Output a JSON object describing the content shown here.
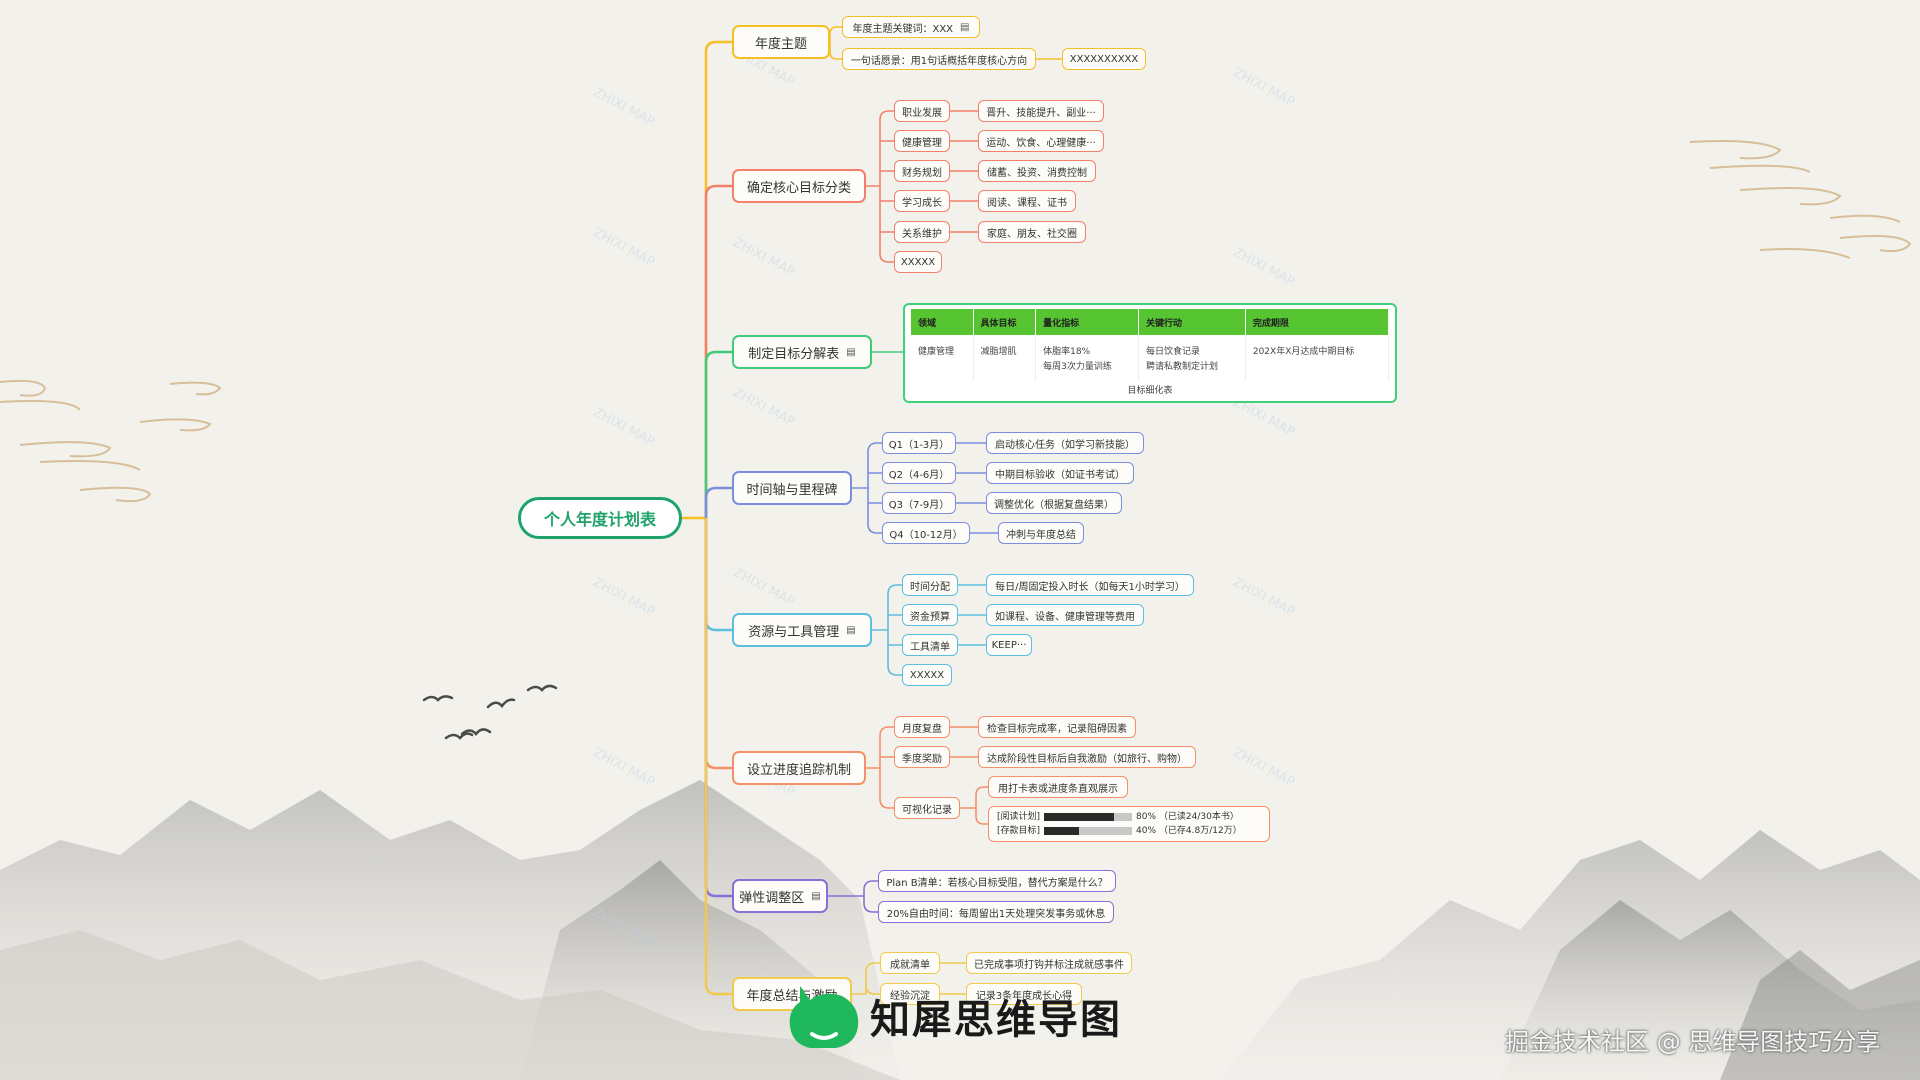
{
  "root": {
    "label": "个人年度计划表"
  },
  "theme": {
    "label": "年度主题",
    "items": [
      {
        "label": "年度主题关键词：XXX",
        "note_icon": "note-icon"
      },
      {
        "label": "一句话愿景：用1句话概括年度核心方向",
        "value": "XXXXXXXXXX"
      }
    ]
  },
  "goals": {
    "label": "确定核心目标分类",
    "items": [
      {
        "label": "职业发展",
        "detail": "晋升、技能提升、副业···"
      },
      {
        "label": "健康管理",
        "detail": "运动、饮食、心理健康···"
      },
      {
        "label": "财务规划",
        "detail": "储蓄、投资、消费控制"
      },
      {
        "label": "学习成长",
        "detail": "阅读、课程、证书"
      },
      {
        "label": "关系维护",
        "detail": "家庭、朋友、社交圈"
      },
      {
        "label": "XXXXX"
      }
    ]
  },
  "decompose": {
    "label": "制定目标分解表",
    "note_icon": "note-icon",
    "table": {
      "headers": [
        "领域",
        "具体目标",
        "量化指标",
        "关键行动",
        "完成期限"
      ],
      "row": [
        "健康管理",
        "减脂增肌",
        "体脂率18%\n每周3次力量训练",
        "每日饮食记录\n聘请私教制定计划",
        "202X年X月达成中期目标"
      ],
      "caption": "目标细化表"
    }
  },
  "timeline": {
    "label": "时间轴与里程碑",
    "items": [
      {
        "label": "Q1（1-3月）",
        "detail": "启动核心任务（如学习新技能）"
      },
      {
        "label": "Q2（4-6月）",
        "detail": "中期目标验收（如证书考试）"
      },
      {
        "label": "Q3（7-9月）",
        "detail": "调整优化（根据复盘结果）"
      },
      {
        "label": "Q4（10-12月）",
        "detail": "冲刺与年度总结"
      }
    ]
  },
  "resources": {
    "label": "资源与工具管理",
    "note_icon": "note-icon",
    "items": [
      {
        "label": "时间分配",
        "detail": "每日/周固定投入时长（如每天1小时学习）"
      },
      {
        "label": "资金预算",
        "detail": "如课程、设备、健康管理等费用"
      },
      {
        "label": "工具清单",
        "detail": "KEEP···"
      },
      {
        "label": "XXXXX"
      }
    ]
  },
  "tracking": {
    "label": "设立进度追踪机制",
    "items": [
      {
        "label": "月度复盘",
        "detail": "检查目标完成率，记录阻碍因素"
      },
      {
        "label": "季度奖励",
        "detail": "达成阶段性目标后自我激励（如旅行、购物）"
      },
      {
        "label": "可视化记录",
        "detail": "用打卡表或进度条直观展示"
      }
    ],
    "progress": [
      {
        "label": "[阅读计划]",
        "percent": 80,
        "text": "80% （已读24/30本书）"
      },
      {
        "label": "[存款目标]",
        "percent": 40,
        "text": "40% （已存4.8万/12万）"
      }
    ]
  },
  "flex": {
    "label": "弹性调整区",
    "note_icon": "note-icon",
    "items": [
      {
        "label": "Plan B清单：若核心目标受阻，替代方案是什么？"
      },
      {
        "label": "20%自由时间：每周留出1天处理突发事务或休息"
      }
    ]
  },
  "summary": {
    "label": "年度总结与激励",
    "items": [
      {
        "label": "成就清单",
        "detail": "已完成事项打钩并标注成就感事件"
      },
      {
        "label": "经验沉淀",
        "detail": "记录3条年度成长心得"
      }
    ]
  },
  "brand": {
    "name": "知犀思维导图"
  },
  "credit": "掘金技术社区 @ 思维导图技巧分享",
  "colors": {
    "root": "#1fa36b",
    "theme": "#f6bf26",
    "goals": "#f47f6b",
    "decompose": "#42c97a",
    "timeline": "#7b8fde",
    "resources": "#5dbfe0",
    "tracking": "#f4906a",
    "flex": "#8b6fd6",
    "summary": "#f2c94c"
  }
}
